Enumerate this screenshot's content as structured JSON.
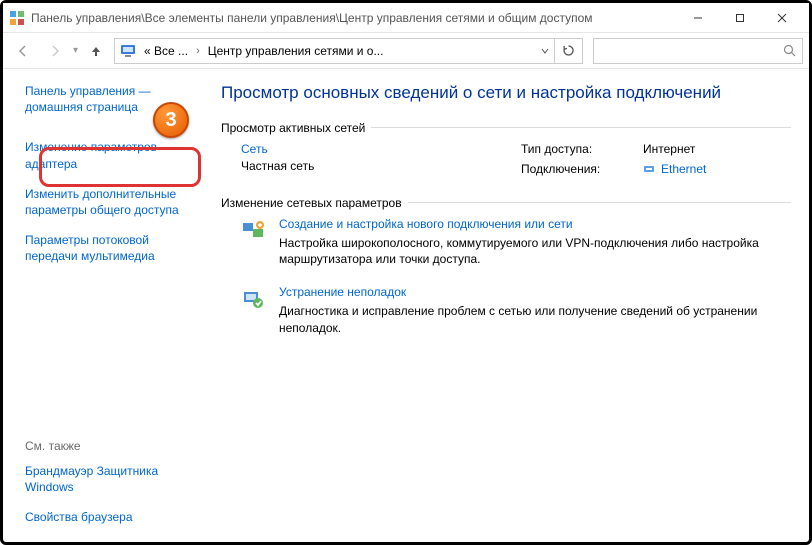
{
  "titlebar": {
    "path": "Панель управления\\Все элементы панели управления\\Центр управления сетями и общим доступом"
  },
  "breadcrumb": {
    "truncated_prefix": "« Все ...",
    "current": "Центр управления сетями и о..."
  },
  "sidebar": {
    "home": "Панель управления — домашняя страница",
    "links": [
      "Изменение параметров адаптера",
      "Изменить дополнительные параметры общего доступа",
      "Параметры потоковой передачи мультимедиа"
    ],
    "see_also_label": "См. также",
    "see_also": [
      "Брандмауэр Защитника Windows",
      "Свойства браузера"
    ]
  },
  "main": {
    "heading": "Просмотр основных сведений о сети и настройка подключений",
    "active_networks_label": "Просмотр активных сетей",
    "network": {
      "name": "Сеть",
      "type": "Частная сеть",
      "access_label": "Тип доступа:",
      "access_value": "Интернет",
      "conn_label": "Подключения:",
      "conn_value": "Ethernet"
    },
    "change_settings_label": "Изменение сетевых параметров",
    "actions": [
      {
        "title": "Создание и настройка нового подключения или сети",
        "desc": "Настройка широкополосного, коммутируемого или VPN-подключения либо настройка маршрутизатора или точки доступа."
      },
      {
        "title": "Устранение неполадок",
        "desc": "Диагностика и исправление проблем с сетью или получение сведений об устранении неполадок."
      }
    ]
  },
  "step_badge": "3"
}
